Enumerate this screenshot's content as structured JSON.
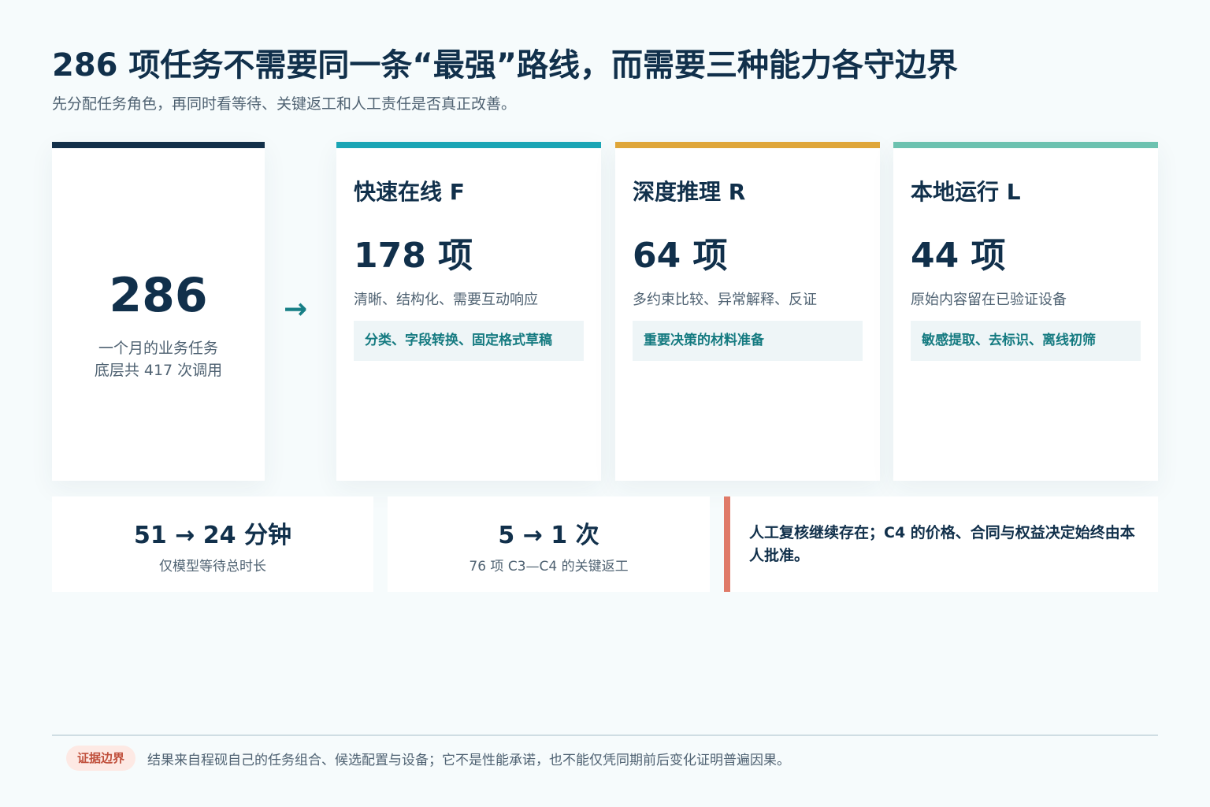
{
  "header": {
    "title": "286 项任务不需要同一条“最强”路线，而需要三种能力各守边界",
    "subtitle": "先分配任务角色，再同时看等待、关键返工和人工责任是否真正改善。"
  },
  "total": {
    "number": "286",
    "line1": "一个月的业务任务",
    "line2": "底层共 417 次调用",
    "arrow": "→"
  },
  "roles": [
    {
      "name": "快速在线 F",
      "count": "178 项",
      "desc": "清晰、结构化、需要互动响应",
      "tag": "分类、字段转换、固定格式草稿",
      "accent": "#1aa5b5"
    },
    {
      "name": "深度推理 R",
      "count": "64 项",
      "desc": "多约束比较、异常解释、反证",
      "tag": "重要决策的材料准备",
      "accent": "#dfa63a"
    },
    {
      "name": "本地运行 L",
      "count": "44 项",
      "desc": "原始内容留在已验证设备",
      "tag": "敏感提取、去标识、离线初筛",
      "accent": "#6cc2b0"
    }
  ],
  "metrics": [
    {
      "value": "51 → 24 分钟",
      "label": "仅模型等待总时长"
    },
    {
      "value": "5 → 1 次",
      "label": "76 项 C3—C4 的关键返工"
    }
  ],
  "note": {
    "text": "人工复核继续存在；C4 的价格、合同与权益决定始终由本人批准。",
    "accent": "#e07a68"
  },
  "footer": {
    "badge": "证据边界",
    "text": "结果来自程砚自己的任务组合、候选配置与设备；它不是性能承诺，也不能仅凭同期前后变化证明普遍因果。"
  }
}
